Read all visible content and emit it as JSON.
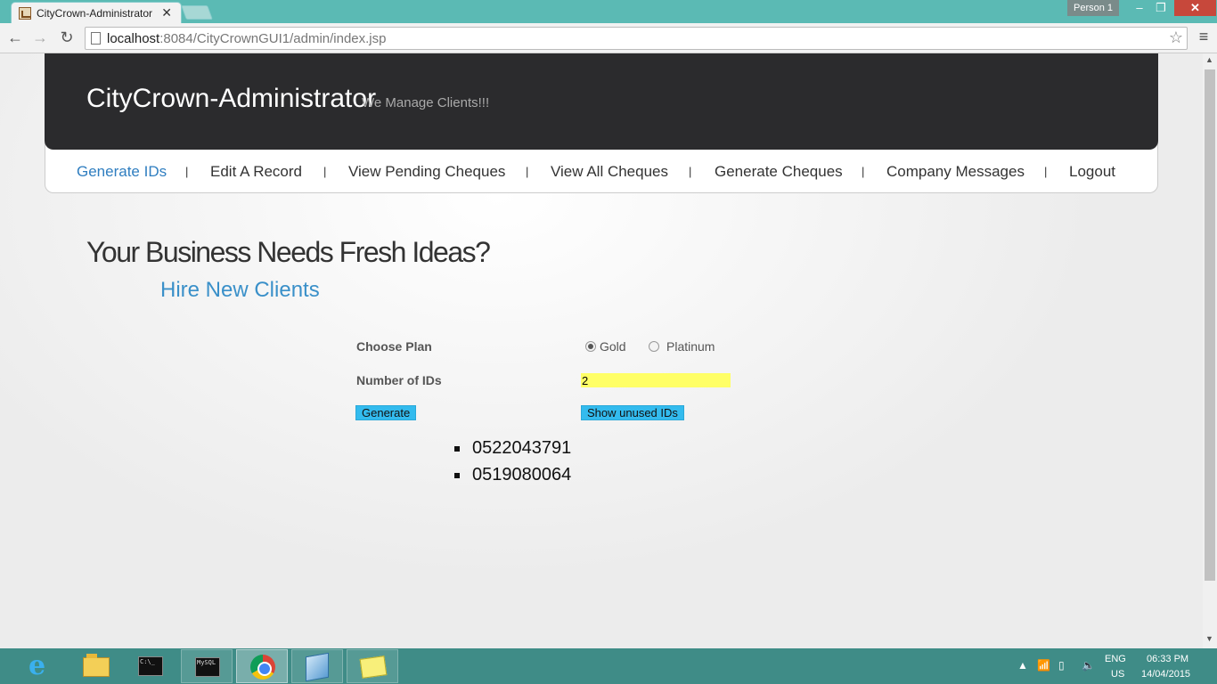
{
  "browser": {
    "tab_title": "CityCrown-Administrator",
    "profile": "Person 1",
    "url_host": "localhost",
    "url_rest": ":8084/CityCrownGUI1/admin/index.jsp"
  },
  "header": {
    "logo": "CityCrown-Administrator",
    "tagline": "We Manage Clients!!!"
  },
  "menu": {
    "items": [
      {
        "label": "Generate IDs",
        "active": true
      },
      {
        "label": "Edit A Record"
      },
      {
        "label": "View Pending Cheques"
      },
      {
        "label": "View All Cheques"
      },
      {
        "label": "Generate Cheques"
      },
      {
        "label": "Company Messages"
      },
      {
        "label": "Logout"
      }
    ],
    "separator": "|"
  },
  "hero": {
    "headline": "Your Business Needs Fresh Ideas?",
    "subheadline": "Hire New Clients"
  },
  "form": {
    "plan_label": "Choose Plan",
    "plan_options": [
      {
        "label": "Gold",
        "checked": true
      },
      {
        "label": "Platinum",
        "checked": false
      }
    ],
    "number_label": "Number of IDs",
    "number_value": "2",
    "generate_button": "Generate",
    "unused_button": "Show unused IDs"
  },
  "generated_ids": [
    "0522043791",
    "0519080064"
  ],
  "taskbar": {
    "language": "ENG",
    "region": "US",
    "time": "06:33 PM",
    "date": "14/04/2015"
  },
  "colors": {
    "titlebar": "#5bbab4",
    "header_bg": "#2b2b2d",
    "active_link": "#2f7ec0",
    "subheadline": "#3a90c9",
    "input_highlight": "#ffff66",
    "button_bg": "#33bbee",
    "taskbar": "#3f8c87"
  }
}
